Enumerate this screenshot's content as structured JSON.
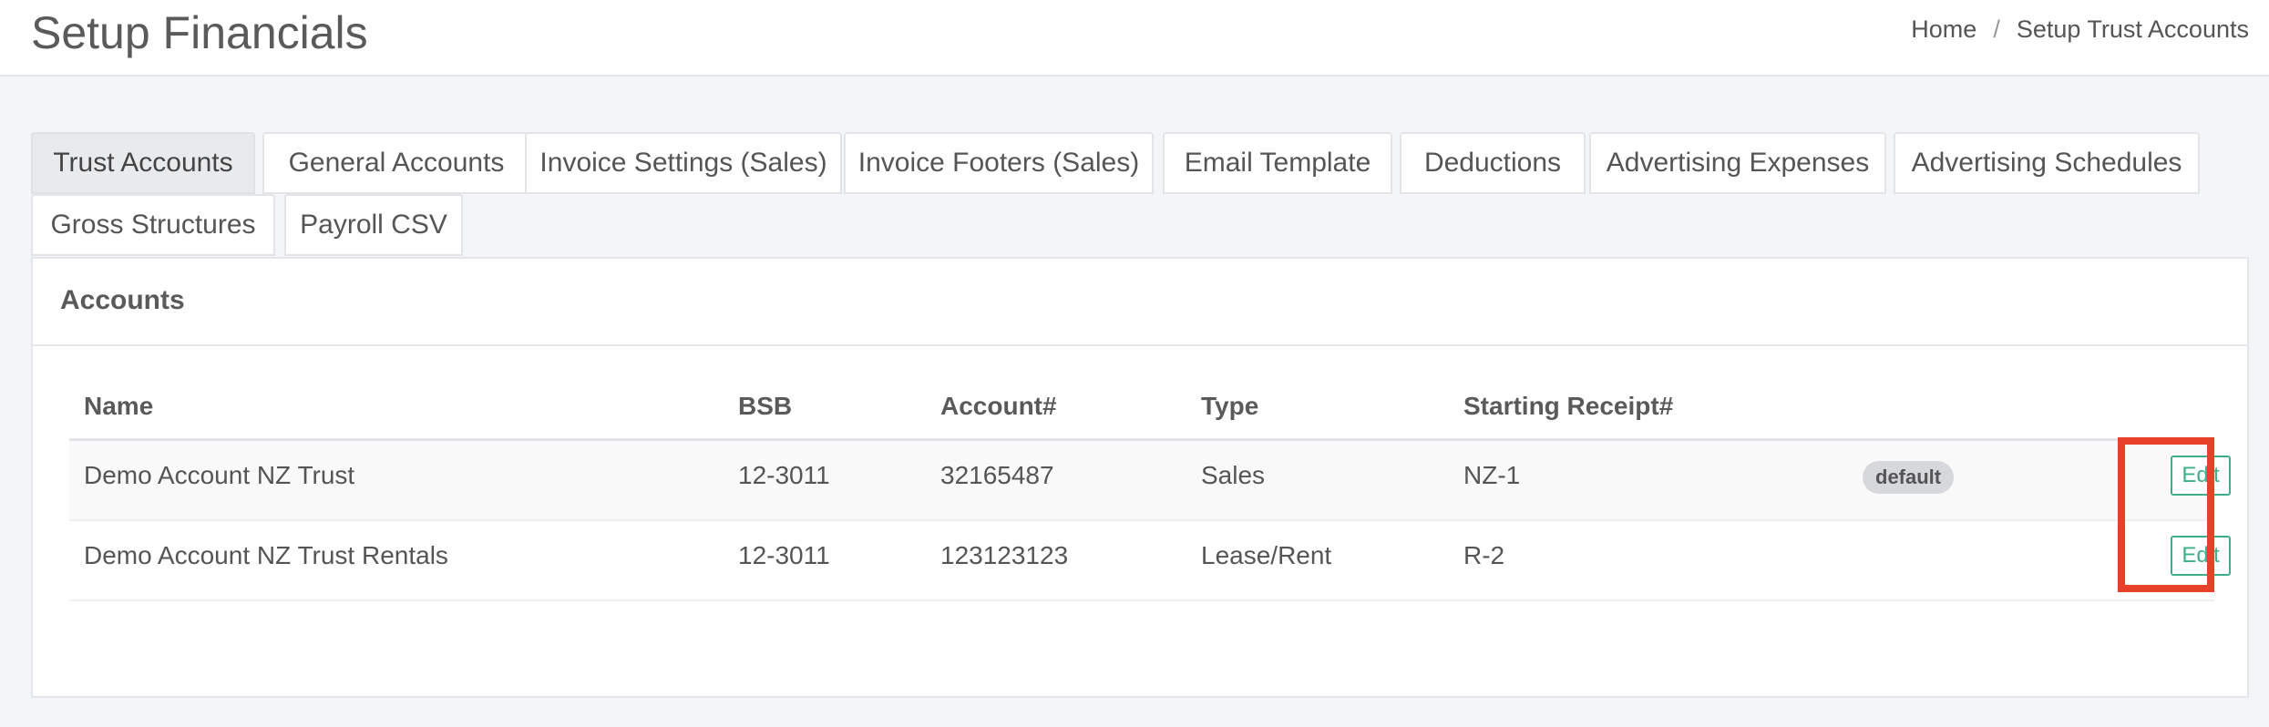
{
  "header": {
    "title": "Setup Financials",
    "breadcrumb": [
      "Home",
      "Setup Trust Accounts"
    ],
    "breadcrumb_separator": "/"
  },
  "tabs": [
    {
      "label": "Trust Accounts",
      "active": true
    },
    {
      "label": "General Accounts"
    },
    {
      "label": "Invoice Settings (Sales)"
    },
    {
      "label": "Invoice Footers (Sales)"
    },
    {
      "label": "Email Template"
    },
    {
      "label": "Deductions"
    },
    {
      "label": "Advertising Expenses"
    },
    {
      "label": "Advertising Schedules"
    },
    {
      "label": "Gross Structures"
    },
    {
      "label": "Payroll CSV"
    }
  ],
  "panel": {
    "title": "Accounts",
    "columns": [
      "Name",
      "BSB",
      "Account#",
      "Type",
      "Starting Receipt#"
    ],
    "rows": [
      {
        "name": "Demo Account NZ Trust",
        "bsb": "12-3011",
        "account": "32165487",
        "type": "Sales",
        "receipt": "NZ-1",
        "badge": "default",
        "action": "Edit"
      },
      {
        "name": "Demo Account NZ Trust Rentals",
        "bsb": "12-3011",
        "account": "123123123",
        "type": "Lease/Rent",
        "receipt": "R-2",
        "action": "Edit"
      }
    ]
  },
  "colors": {
    "accent": "#3fae8c",
    "highlight": "#e8412a",
    "badge_bg": "#d6d8db"
  }
}
